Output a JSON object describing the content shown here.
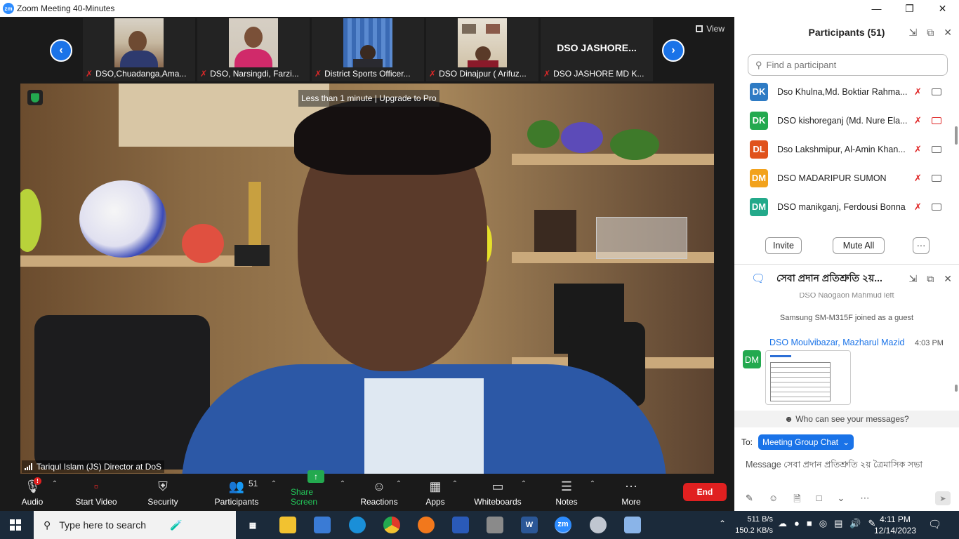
{
  "window": {
    "title": "Zoom Meeting 40-Minutes",
    "logo": "zm"
  },
  "thumbnails": [
    {
      "name": "DSO,Chuadanga,Ama..."
    },
    {
      "name": "DSO, Narsingdi, Farzi..."
    },
    {
      "name": "District Sports Officer..."
    },
    {
      "name": "DSO Dinajpur ( Arifuz..."
    },
    {
      "name": "DSO JASHORE MD K...",
      "display": "DSO  JASHORE..."
    }
  ],
  "view_label": "View",
  "banner": "Less than 1 minute | Upgrade to Pro",
  "active_speaker": "Tariqul Islam (JS) Director at DoS",
  "toolbar": {
    "audio": "Audio",
    "start_video": "Start Video",
    "security": "Security",
    "participants": "Participants",
    "participants_count": "51",
    "share_screen": "Share Screen",
    "reactions": "Reactions",
    "apps": "Apps",
    "whiteboards": "Whiteboards",
    "notes": "Notes",
    "more": "More",
    "end": "End",
    "audio_badge": "!"
  },
  "participants_panel": {
    "title": "Participants (51)",
    "search_placeholder": "Find a participant",
    "items": [
      {
        "initials": "DK",
        "name": "Dso Khulna,Md. Boktiar Rahma...",
        "color": "#2e7bc4",
        "video_off": false
      },
      {
        "initials": "DK",
        "name": "DSO kishoreganj (Md. Nure Ela...",
        "color": "#23a94f",
        "video_off": true
      },
      {
        "initials": "DL",
        "name": "Dso Lakshmipur, Al-Amin Khan...",
        "color": "#e0521c",
        "video_off": false
      },
      {
        "initials": "DM",
        "name": "DSO MADARIPUR SUMON",
        "color": "#f2a21c",
        "video_off": false
      },
      {
        "initials": "DM",
        "name": "DSO manikganj, Ferdousi Bonna",
        "color": "#23a98a",
        "video_off": false
      }
    ],
    "invite": "Invite",
    "mute_all": "Mute All",
    "more": "···"
  },
  "chat_panel": {
    "title": "সেবা প্রদান প্রতিশ্রুতি ২য়...",
    "cut_text": "DSO Naogaon Mahmud left",
    "joined_text": "Samsung SM-M315F joined as a guest",
    "sender": "DSO Moulvibazar, Mazharul Mazid",
    "time": "4:03 PM",
    "sender_initials": "DM",
    "who_can_see": "Who can see your messages?",
    "to_label": "To:",
    "to_value": "Meeting Group Chat",
    "message_placeholder": "Message সেবা প্রদান প্রতিশ্রুতি ২য় ত্রৈমাসিক সভা"
  },
  "taskbar": {
    "search_placeholder": "Type here to search",
    "net_up": "511 B/s",
    "net_down": "150.2 KB/s",
    "time": "4:11 PM",
    "date": "12/14/2023",
    "zoom_label": "zm",
    "word_label": "W"
  }
}
